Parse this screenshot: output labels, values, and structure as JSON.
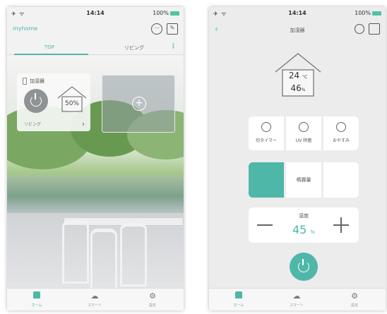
{
  "left": {
    "status": {
      "time": "14:14",
      "battery": "100%"
    },
    "home_name": "myhome",
    "tabs": [
      "TOP",
      "リビング"
    ],
    "device": {
      "name": "加湿器",
      "humidity": "50%",
      "room": "リビング"
    },
    "nav": [
      "ホーム",
      "スマート",
      "設定"
    ]
  },
  "right": {
    "status": {
      "time": "14:14",
      "battery": "100%"
    },
    "title": "加湿器",
    "temperature": {
      "value": "24",
      "unit": "°C"
    },
    "humidity": {
      "value": "46",
      "unit": "%"
    },
    "modes": [
      "切タイマー",
      "UV 除菌",
      "おやすみ"
    ],
    "mist_label": "噴霧量",
    "humidity_setting": {
      "label": "湿度",
      "value": "45",
      "unit": "%"
    },
    "nav": [
      "ホーム",
      "スマート",
      "設定"
    ]
  },
  "colors": {
    "accent": "#4fb7a8",
    "power_off": "#8f9396"
  }
}
